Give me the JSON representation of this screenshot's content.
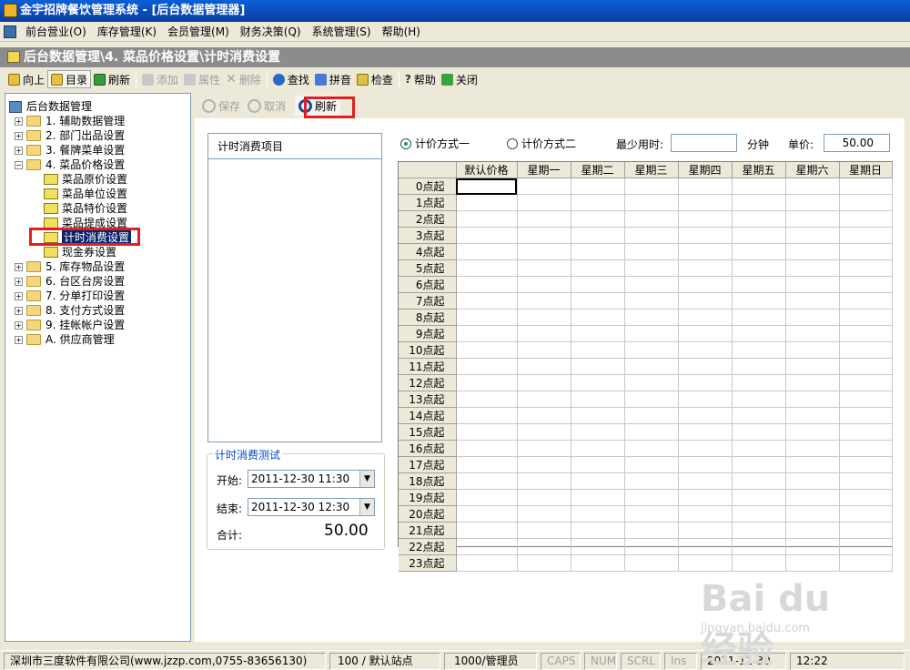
{
  "window": {
    "title": "金宇招牌餐饮管理系统 - [后台数据管理器]"
  },
  "menu": [
    "前台营业(O)",
    "库存管理(K)",
    "会员管理(M)",
    "财务决策(Q)",
    "系统管理(S)",
    "帮助(H)"
  ],
  "path": "后台数据管理\\4. 菜品价格设置\\计时消费设置",
  "toolbar": {
    "up": "向上",
    "dir": "目录",
    "refresh": "刷新",
    "add": "添加",
    "props": "属性",
    "del": "删除",
    "find": "查找",
    "pinyin": "拼音",
    "check": "检查",
    "help": "帮助",
    "close": "关闭"
  },
  "tree": {
    "root": "后台数据管理",
    "items": [
      "1. 辅助数据管理",
      "2. 部门出品设置",
      "3. 餐牌菜单设置",
      "4. 菜品价格设置"
    ],
    "children": [
      "菜品原价设置",
      "菜品单位设置",
      "菜品特价设置",
      "菜品提成设置",
      "计时消费设置",
      "现金券设置"
    ],
    "items2": [
      "5. 库存物品设置",
      "6. 台区台房设置",
      "7. 分单打印设置",
      "8. 支付方式设置",
      "9. 挂帐帐户设置",
      "A. 供应商管理"
    ]
  },
  "rtoolbar": {
    "save": "保存",
    "cancel": "取消",
    "refresh": "刷新"
  },
  "items_panel": {
    "header": "计时消费项目"
  },
  "test": {
    "legend": "计时消费测试",
    "start_label": "开始:",
    "start_value": "2011-12-30 11:30",
    "end_label": "结束:",
    "end_value": "2011-12-30 12:30",
    "total_label": "合计:",
    "total_value": "50.00"
  },
  "pricing": {
    "mode1": "计价方式一",
    "mode2": "计价方式二",
    "selected": "mode1",
    "min_label": "最少用时:",
    "min_value": "",
    "min_unit": "分钟",
    "price_label": "单价:",
    "price_value": "50.00"
  },
  "grid": {
    "columns": [
      "默认价格",
      "星期一",
      "星期二",
      "星期三",
      "星期四",
      "星期五",
      "星期六",
      "星期日"
    ],
    "rows": [
      "0点起",
      "1点起",
      "2点起",
      "3点起",
      "4点起",
      "5点起",
      "6点起",
      "7点起",
      "8点起",
      "9点起",
      "10点起",
      "11点起",
      "12点起",
      "13点起",
      "14点起",
      "15点起",
      "16点起",
      "17点起",
      "18点起",
      "19点起",
      "20点起",
      "21点起",
      "22点起",
      "23点起"
    ]
  },
  "status": {
    "company": "深圳市三度软件有限公司(www.jzzp.com,0755-83656130)",
    "station": "100 / 默认站点",
    "user": "1000/管理员",
    "caps": "CAPS",
    "num": "NUM",
    "scrl": "SCRL",
    "ins": "Ins",
    "date": "2011-12-30",
    "time": "12:22"
  },
  "watermark": {
    "logo": "Bai du 经验",
    "url": "jingyan.baidu.com"
  },
  "colors": {
    "highlight": "#e02020",
    "title_bar": "#0b49b8",
    "path_bar": "#8c8c8c",
    "selected": "#0a246a"
  }
}
